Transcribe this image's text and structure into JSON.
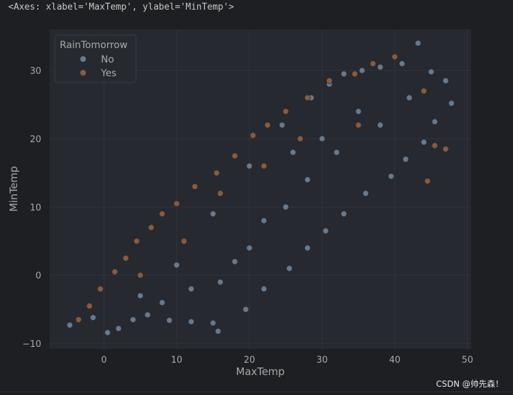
{
  "output": {
    "repr": "<Axes: xlabel='MaxTemp', ylabel='MinTemp'>"
  },
  "watermark": "CSDN @帅先森！",
  "colors": {
    "page_background": "#1e1f22",
    "axes_background": "#262930",
    "grid": "#31343a",
    "text": "#a9a9a9",
    "point_edge": "#2b2d31",
    "no": "#66798e",
    "yes": "#8c5a3a"
  },
  "chart_data": {
    "type": "scatter",
    "title": "",
    "xlabel": "MaxTemp",
    "ylabel": "MinTemp",
    "xlim": [
      -7.5,
      50.5
    ],
    "ylim": [
      -10.8,
      36
    ],
    "xticks": [
      "0",
      "10",
      "20",
      "30",
      "40",
      "50"
    ],
    "yticks": [
      "−10",
      "0",
      "10",
      "20",
      "30"
    ],
    "grid": true,
    "legend": {
      "title": "RainTomorrow",
      "position": "top-left",
      "entries": [
        "No",
        "Yes"
      ]
    },
    "series": [
      {
        "name": "No",
        "color": "#66798e",
        "points": [
          [
            -4.7,
            -7.3
          ],
          [
            -1.5,
            -6.2
          ],
          [
            0.5,
            -8.4
          ],
          [
            2.0,
            -7.8
          ],
          [
            4.0,
            -6.5
          ],
          [
            6.0,
            -5.8
          ],
          [
            9.0,
            -6.6
          ],
          [
            12.0,
            -6.8
          ],
          [
            15.0,
            -7.0
          ],
          [
            15.7,
            -8.2
          ],
          [
            19.5,
            -5.0
          ],
          [
            22.0,
            -2.0
          ],
          [
            25.5,
            1.0
          ],
          [
            28.0,
            4.0
          ],
          [
            30.5,
            6.5
          ],
          [
            33.0,
            9.0
          ],
          [
            36.0,
            12.0
          ],
          [
            39.5,
            14.5
          ],
          [
            41.5,
            17.0
          ],
          [
            44.0,
            19.5
          ],
          [
            45.5,
            22.5
          ],
          [
            47.8,
            25.2
          ],
          [
            47.0,
            28.5
          ],
          [
            45.0,
            29.8
          ],
          [
            43.2,
            34.0
          ],
          [
            41.0,
            31.0
          ],
          [
            38.0,
            30.5
          ],
          [
            35.5,
            30.0
          ],
          [
            33.0,
            29.5
          ],
          [
            31.0,
            28.0
          ],
          [
            28.5,
            26.0
          ],
          [
            24.5,
            22.0
          ],
          [
            20.0,
            16.0
          ],
          [
            15.0,
            9.0
          ],
          [
            10.0,
            1.5
          ],
          [
            5.0,
            -3.0
          ],
          [
            18.0,
            2.0
          ],
          [
            25.0,
            10.0
          ],
          [
            32.0,
            18.0
          ],
          [
            38.0,
            22.0
          ],
          [
            22.0,
            8.0
          ],
          [
            12.0,
            -2.0
          ],
          [
            35.0,
            24.0
          ],
          [
            28.0,
            14.0
          ],
          [
            16.0,
            -1.0
          ],
          [
            42.0,
            26.0
          ],
          [
            26.0,
            18.0
          ],
          [
            20.0,
            4.0
          ],
          [
            8.0,
            -4.0
          ],
          [
            30.0,
            20.0
          ]
        ]
      },
      {
        "name": "Yes",
        "color": "#8c5a3a",
        "points": [
          [
            -3.5,
            -6.5
          ],
          [
            -2.0,
            -4.5
          ],
          [
            -0.5,
            -2.0
          ],
          [
            1.5,
            0.5
          ],
          [
            3.0,
            2.5
          ],
          [
            4.5,
            5.0
          ],
          [
            6.5,
            7.0
          ],
          [
            8.0,
            9.0
          ],
          [
            10.0,
            10.5
          ],
          [
            12.5,
            13.0
          ],
          [
            15.5,
            15.0
          ],
          [
            18.0,
            17.5
          ],
          [
            20.5,
            20.5
          ],
          [
            22.5,
            22.0
          ],
          [
            25.0,
            24.0
          ],
          [
            28.0,
            26.0
          ],
          [
            31.0,
            28.5
          ],
          [
            34.5,
            29.5
          ],
          [
            37.0,
            31.0
          ],
          [
            40.0,
            32.0
          ],
          [
            44.0,
            27.0
          ],
          [
            45.5,
            19.0
          ],
          [
            47.0,
            18.5
          ],
          [
            44.5,
            13.8
          ],
          [
            35.0,
            22.0
          ],
          [
            27.0,
            20.0
          ],
          [
            22.0,
            16.0
          ],
          [
            16.0,
            12.0
          ],
          [
            11.0,
            5.0
          ],
          [
            5.0,
            0.0
          ]
        ]
      }
    ]
  }
}
